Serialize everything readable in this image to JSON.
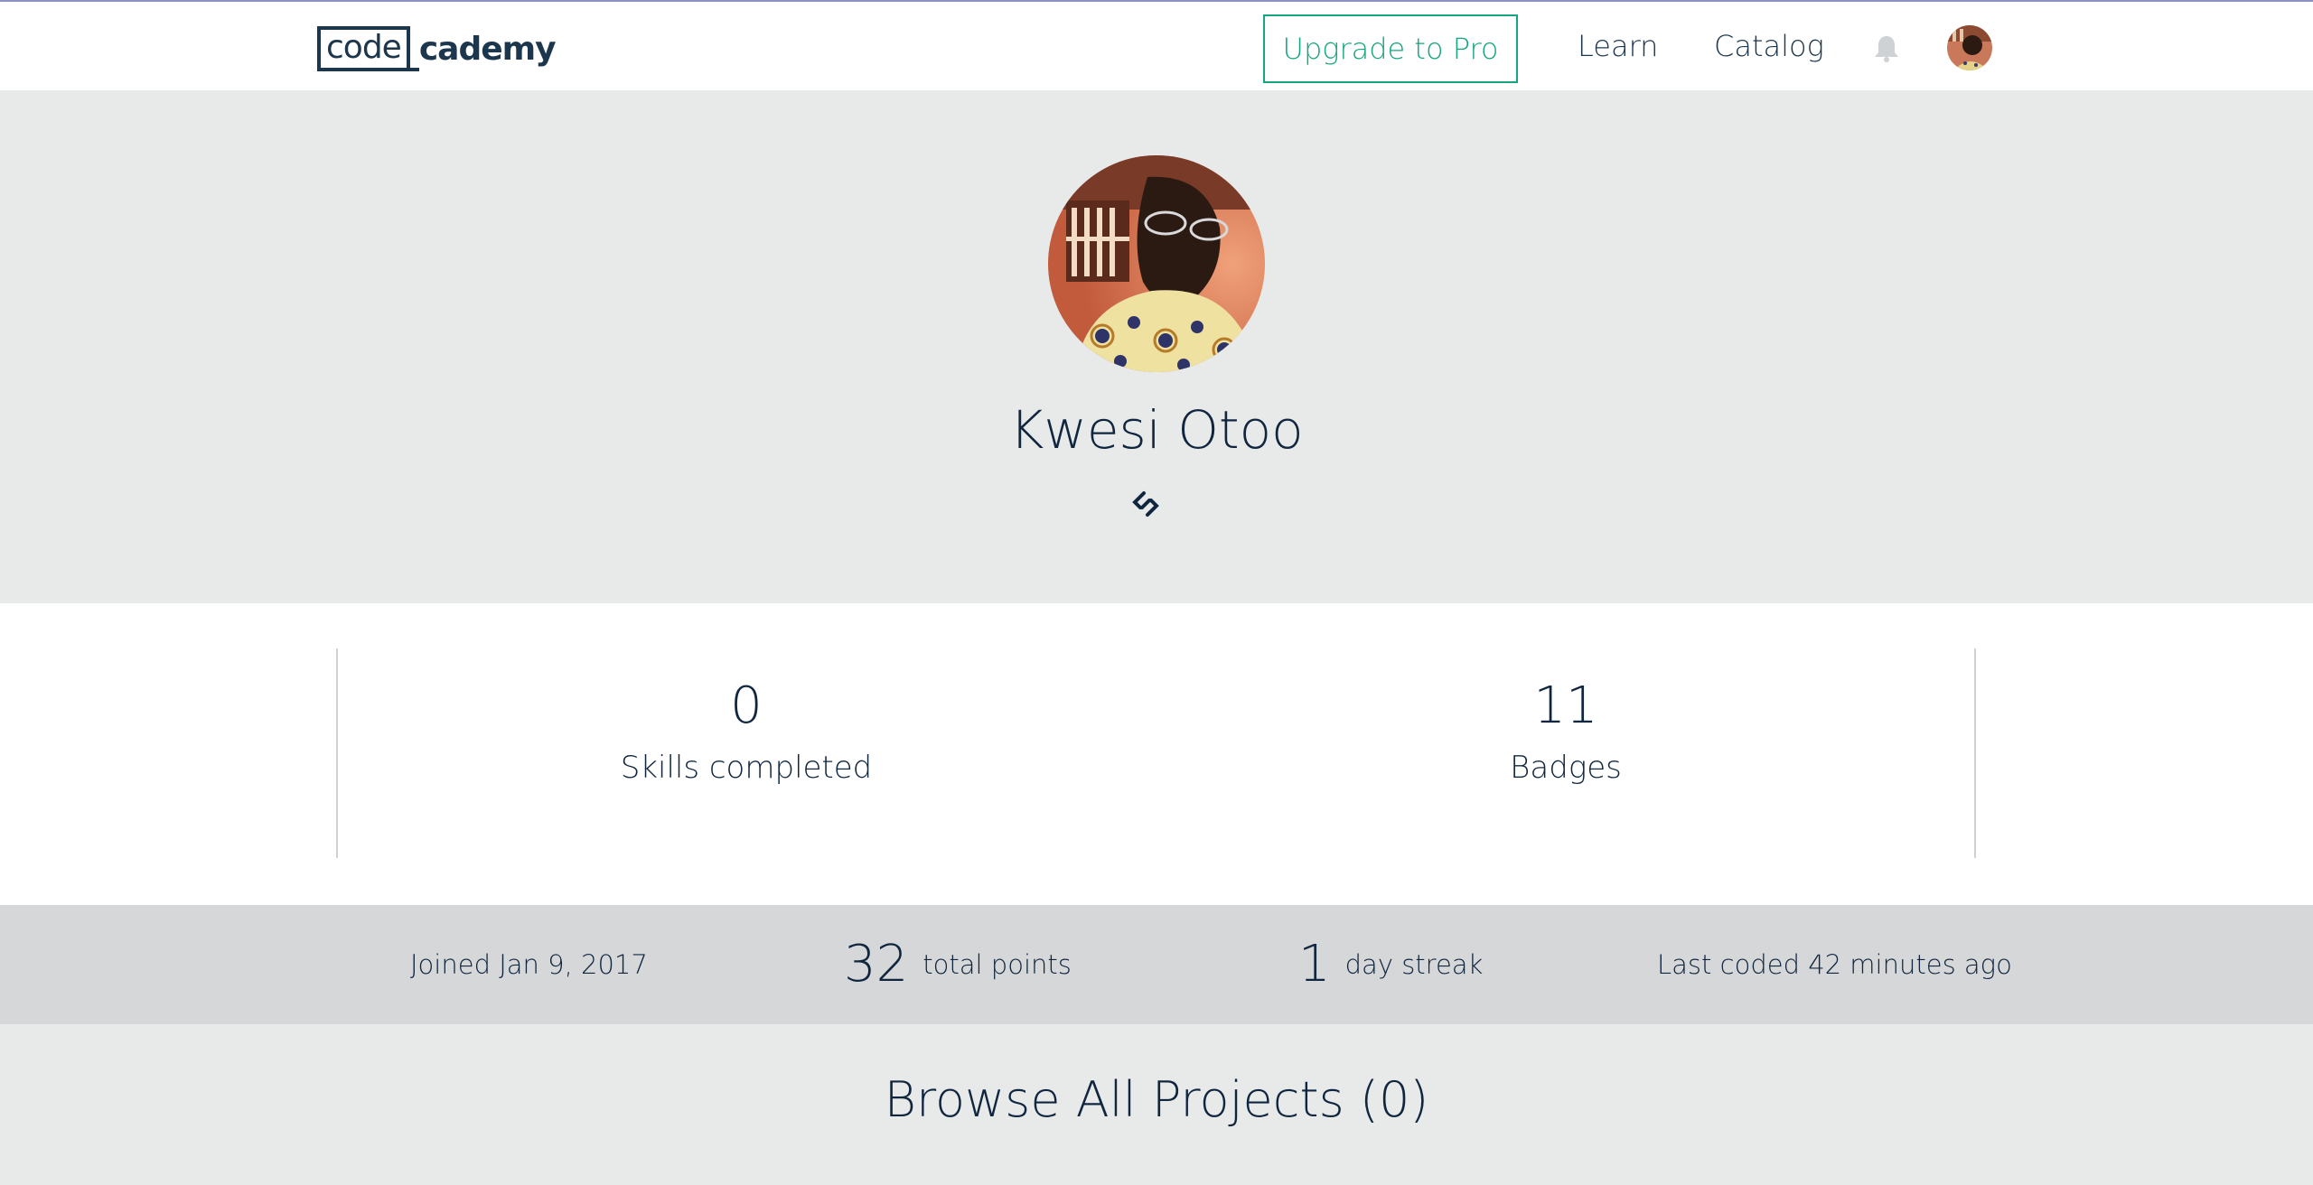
{
  "nav": {
    "logo_box": "code",
    "logo_rest": "cademy",
    "upgrade_label": "Upgrade to Pro",
    "learn_label": "Learn",
    "catalog_label": "Catalog",
    "bell_icon": "bell-icon",
    "avatar_icon": "user-avatar"
  },
  "profile": {
    "name": "Kwesi Otoo",
    "link_icon": "link-icon"
  },
  "stats": {
    "skills_value": "0",
    "skills_label": "Skills completed",
    "badges_value": "11",
    "badges_label": "Badges"
  },
  "activity": {
    "joined": "Joined Jan 9, 2017",
    "points_value": "32",
    "points_label": "total points",
    "streak_value": "1",
    "streak_label": "day streak",
    "last_coded": "Last coded 42 minutes ago"
  },
  "projects": {
    "heading": "Browse All Projects (0)"
  },
  "colors": {
    "accent": "#15a57f",
    "text": "#10263f",
    "hero_bg": "#e8e9e9",
    "strip_bg": "#d6d7d9"
  }
}
